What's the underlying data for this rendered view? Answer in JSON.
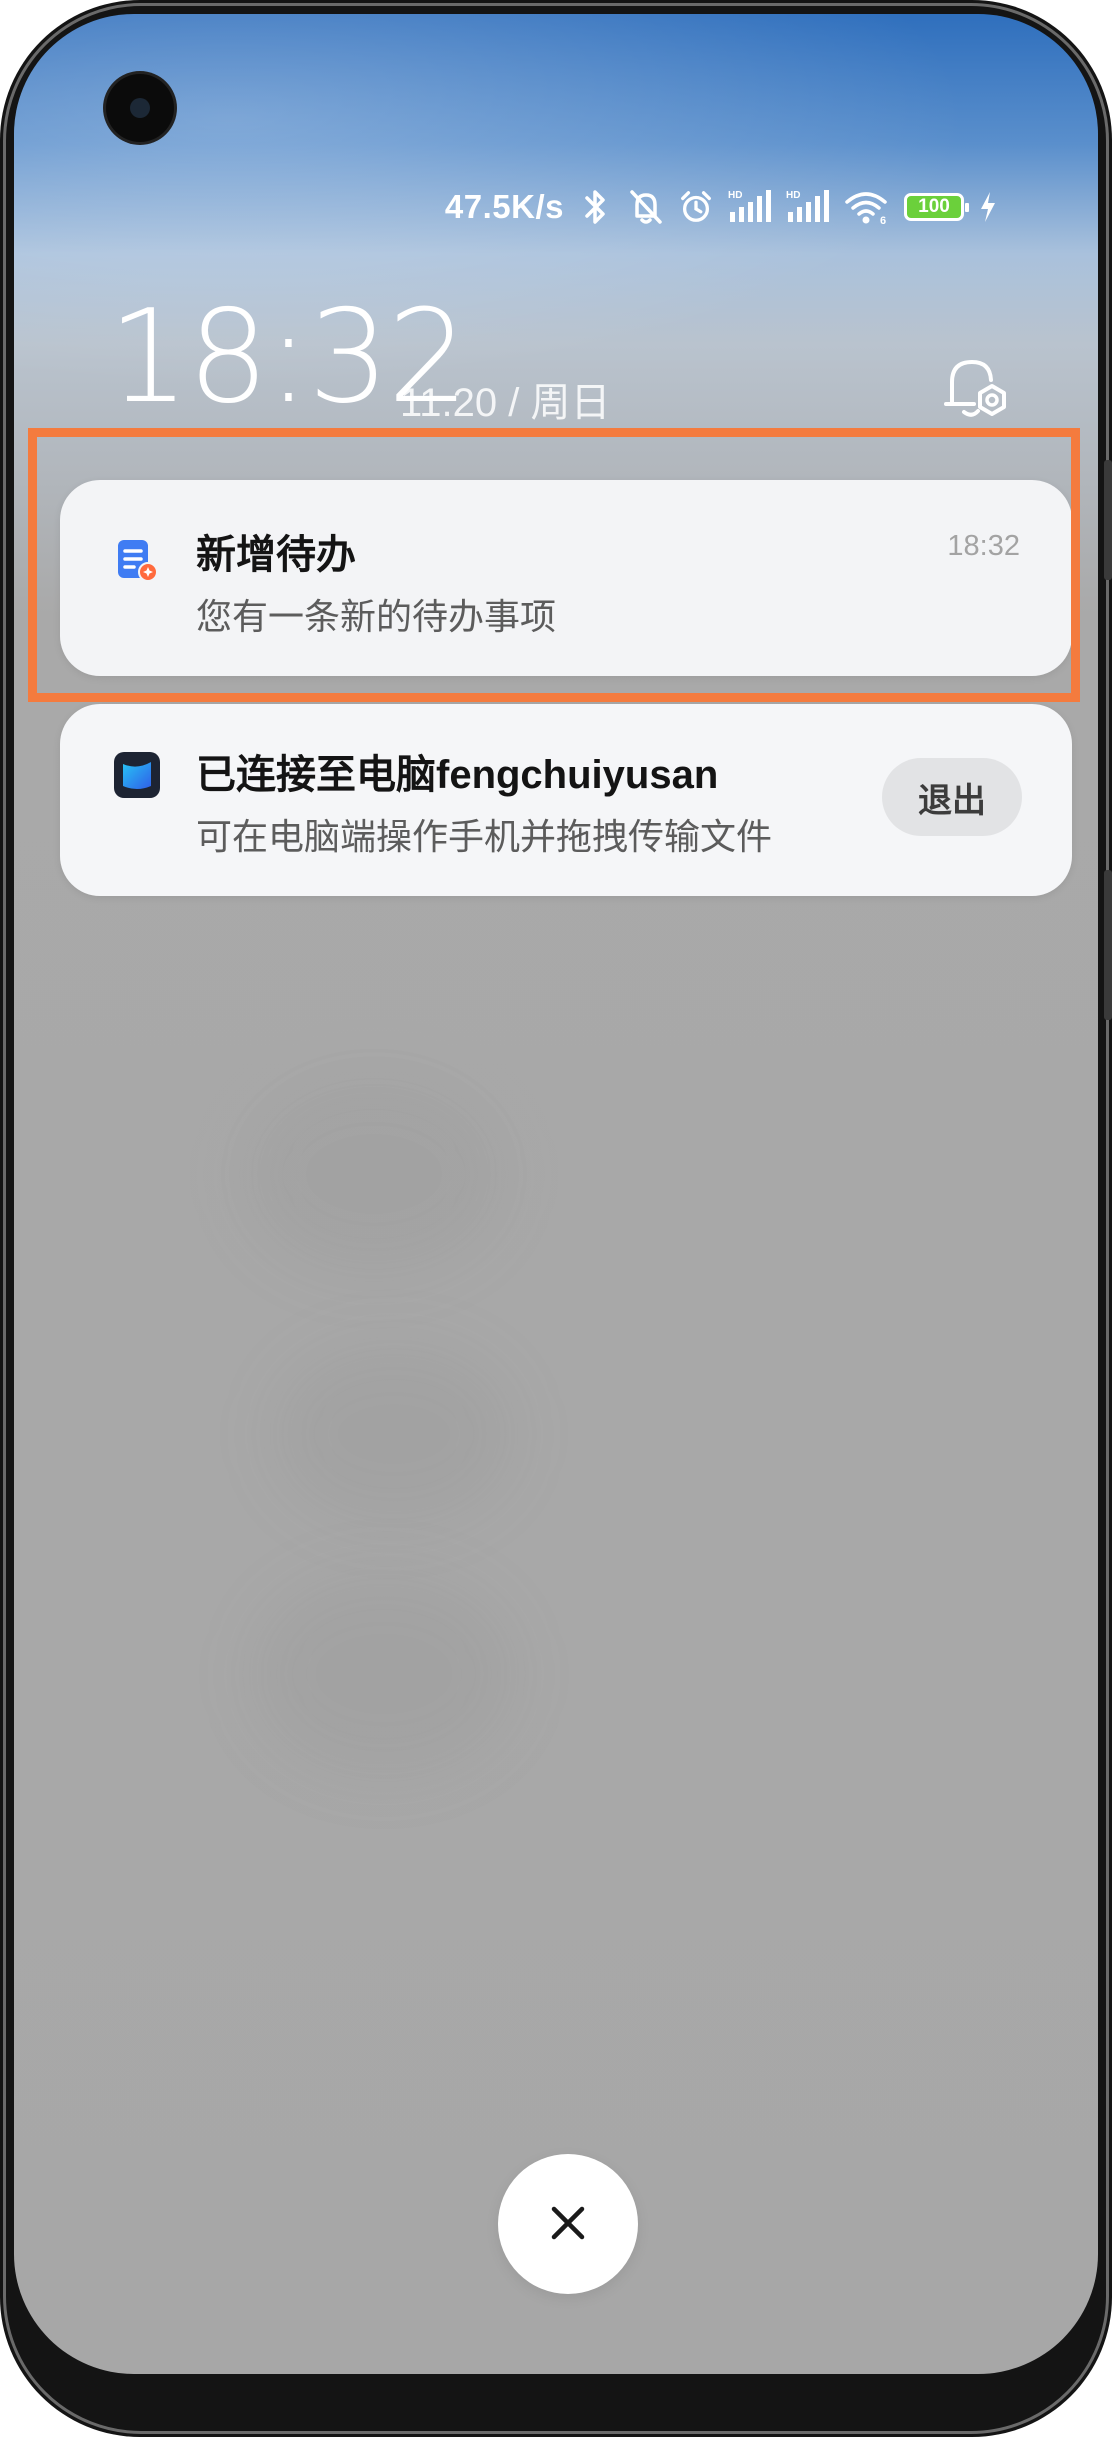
{
  "status_bar": {
    "net_speed": "47.5K/s",
    "icons": [
      "bluetooth-icon",
      "mute-bell-icon",
      "alarm-icon",
      "hd-signal-icon",
      "hd-signal-icon",
      "wifi-6-icon",
      "battery-icon",
      "charging-bolt-icon"
    ],
    "battery_level": "100",
    "battery_color": "#6bd03b"
  },
  "lockscreen": {
    "time": "18:32",
    "date": "11.20 / 周日"
  },
  "highlight_color": "#f47b3e",
  "notifications": [
    {
      "app_icon": "todo-app-icon",
      "title": "新增待办",
      "body": "您有一条新的待办事项",
      "time": "18:32"
    },
    {
      "app_icon": "phone-pc-connect-icon",
      "title": "已连接至电脑fengchuiyusan",
      "body": "可在电脑端操作手机并拖拽传输文件",
      "action_label": "退出"
    }
  ],
  "close_button_icon": "close-icon"
}
